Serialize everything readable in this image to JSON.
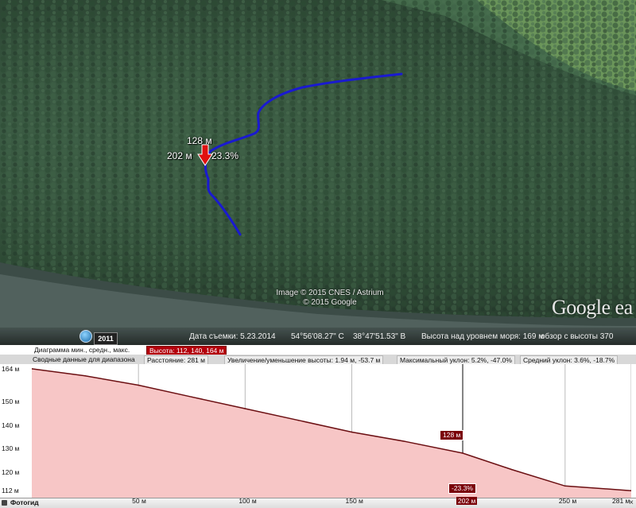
{
  "map": {
    "credits_line1": "Image © 2015 CNES / Astrium",
    "credits_line2": "© 2015 Google",
    "logo": "Google ea",
    "marker": {
      "elevation_label": "128 м",
      "distance_label": "202 м",
      "slope_label": "-23.3%",
      "icon": "red-arrow-down-icon"
    },
    "path_color": "#1a1ad0"
  },
  "statusbar": {
    "year": "2011",
    "date": "Дата съемки: 5.23.2014",
    "lat": "54°56'08.27\" С",
    "lon": "38°47'51.53\" В",
    "altitude": "Высота над уровнем моря:   169 м",
    "eye": "обзор с высоты   370"
  },
  "profile": {
    "row1": {
      "diagram_label": "Диаграмма  мин., средн., макс.",
      "height_value": "Высота: 112, 140, 164 м"
    },
    "row2": {
      "summary_label": "Сводные данные для диапазона",
      "distance": "Расстояние: 281 м",
      "gain_loss": "Увеличение/уменьшение высоты: 1.94 м, -53.7 м",
      "max_slope": "Максимальный уклон: 5.2%, -47.0%",
      "avg_slope": "Средний уклон: 3.6%, -18.7%"
    },
    "cursor": {
      "elevation": "128 м",
      "slope": "-23.3%",
      "distance": "202 м"
    },
    "bottom": {
      "photo_button": "Фотогид",
      "close": "×"
    },
    "fill_color": "#f7c6c6",
    "line_color": "#6b0f12"
  },
  "chart_data": {
    "type": "area",
    "title": "",
    "xlabel": "",
    "ylabel": "",
    "x_ticks": [
      "50 м",
      "100 м",
      "150 м",
      "202 м",
      "250 м",
      "281 м"
    ],
    "x_tick_values": [
      50,
      100,
      150,
      202,
      250,
      281
    ],
    "y_ticks": [
      "112 м",
      "120 м",
      "130 м",
      "140 м",
      "150 м",
      "164 м"
    ],
    "y_tick_values": [
      112,
      120,
      130,
      140,
      150,
      164
    ],
    "xlim": [
      0,
      281
    ],
    "ylim": [
      109,
      166
    ],
    "x": [
      0,
      25,
      50,
      75,
      100,
      125,
      150,
      175,
      202,
      225,
      250,
      281
    ],
    "y": [
      164,
      161,
      157,
      152,
      147,
      142,
      137,
      133,
      128,
      121,
      114,
      112
    ],
    "cursor_x": 202
  }
}
